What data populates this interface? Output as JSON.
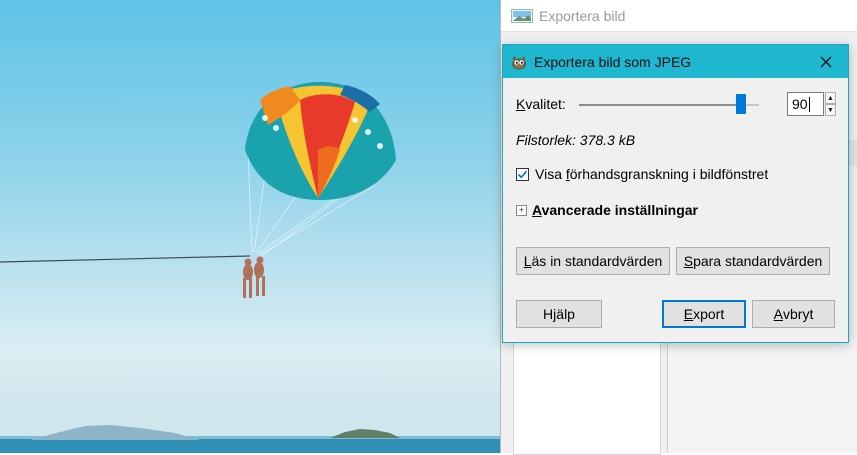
{
  "parent_window": {
    "title": "Exportera bild",
    "icon": "image-icon"
  },
  "dialog": {
    "title": "Exportera bild som JPEG",
    "icon": "gimp-icon",
    "close_icon": "close-icon",
    "quality": {
      "label_first": "K",
      "label_rest": "valitet:",
      "value": "90",
      "min": 0,
      "max": 100
    },
    "filesize": "Filstorlek: 378.3 kB",
    "preview": {
      "label_before": "Visa ",
      "label_ul": "f",
      "label_after": "örhandsgranskning i bildfönstret",
      "checked": true
    },
    "advanced": {
      "label_ul": "A",
      "label_rest": "vancerade inställningar"
    },
    "buttons": {
      "load_ul": "L",
      "load_rest": "äs in standardvärden",
      "save_ul": "S",
      "save_rest": "para standardvärden",
      "help_before": "H",
      "help_ul": "j",
      "help_after": "älp",
      "export_ul": "E",
      "export_rest": "xport",
      "cancel_ul": "A",
      "cancel_rest": "vbryt"
    }
  },
  "colors": {
    "titlebar": "#1fb6cf",
    "accent": "#0078d7"
  }
}
